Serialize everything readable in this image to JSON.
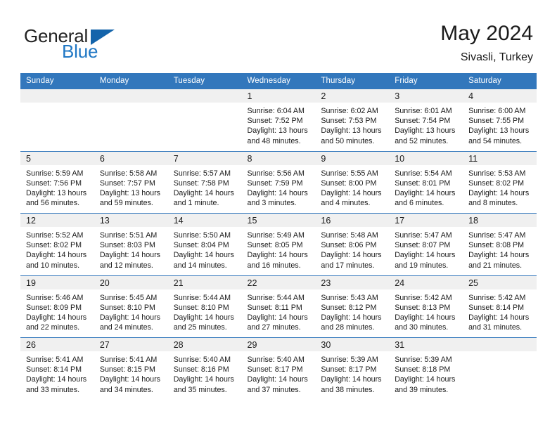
{
  "brand": {
    "name_primary": "General",
    "name_secondary": "Blue",
    "accent_color": "#1f77c4",
    "triangle_color": "#1464ab"
  },
  "header": {
    "month_title": "May 2024",
    "location": "Sivasli, Turkey"
  },
  "calendar": {
    "header_color": "#3277bc",
    "daynum_band_color": "#f0f0f0",
    "weekday_headers": [
      "Sunday",
      "Monday",
      "Tuesday",
      "Wednesday",
      "Thursday",
      "Friday",
      "Saturday"
    ],
    "weeks": [
      [
        {
          "day": "",
          "sunrise": "",
          "sunset": "",
          "daylight_line1": "",
          "daylight_line2": ""
        },
        {
          "day": "",
          "sunrise": "",
          "sunset": "",
          "daylight_line1": "",
          "daylight_line2": ""
        },
        {
          "day": "",
          "sunrise": "",
          "sunset": "",
          "daylight_line1": "",
          "daylight_line2": ""
        },
        {
          "day": "1",
          "sunrise": "Sunrise: 6:04 AM",
          "sunset": "Sunset: 7:52 PM",
          "daylight_line1": "Daylight: 13 hours",
          "daylight_line2": "and 48 minutes."
        },
        {
          "day": "2",
          "sunrise": "Sunrise: 6:02 AM",
          "sunset": "Sunset: 7:53 PM",
          "daylight_line1": "Daylight: 13 hours",
          "daylight_line2": "and 50 minutes."
        },
        {
          "day": "3",
          "sunrise": "Sunrise: 6:01 AM",
          "sunset": "Sunset: 7:54 PM",
          "daylight_line1": "Daylight: 13 hours",
          "daylight_line2": "and 52 minutes."
        },
        {
          "day": "4",
          "sunrise": "Sunrise: 6:00 AM",
          "sunset": "Sunset: 7:55 PM",
          "daylight_line1": "Daylight: 13 hours",
          "daylight_line2": "and 54 minutes."
        }
      ],
      [
        {
          "day": "5",
          "sunrise": "Sunrise: 5:59 AM",
          "sunset": "Sunset: 7:56 PM",
          "daylight_line1": "Daylight: 13 hours",
          "daylight_line2": "and 56 minutes."
        },
        {
          "day": "6",
          "sunrise": "Sunrise: 5:58 AM",
          "sunset": "Sunset: 7:57 PM",
          "daylight_line1": "Daylight: 13 hours",
          "daylight_line2": "and 59 minutes."
        },
        {
          "day": "7",
          "sunrise": "Sunrise: 5:57 AM",
          "sunset": "Sunset: 7:58 PM",
          "daylight_line1": "Daylight: 14 hours",
          "daylight_line2": "and 1 minute."
        },
        {
          "day": "8",
          "sunrise": "Sunrise: 5:56 AM",
          "sunset": "Sunset: 7:59 PM",
          "daylight_line1": "Daylight: 14 hours",
          "daylight_line2": "and 3 minutes."
        },
        {
          "day": "9",
          "sunrise": "Sunrise: 5:55 AM",
          "sunset": "Sunset: 8:00 PM",
          "daylight_line1": "Daylight: 14 hours",
          "daylight_line2": "and 4 minutes."
        },
        {
          "day": "10",
          "sunrise": "Sunrise: 5:54 AM",
          "sunset": "Sunset: 8:01 PM",
          "daylight_line1": "Daylight: 14 hours",
          "daylight_line2": "and 6 minutes."
        },
        {
          "day": "11",
          "sunrise": "Sunrise: 5:53 AM",
          "sunset": "Sunset: 8:02 PM",
          "daylight_line1": "Daylight: 14 hours",
          "daylight_line2": "and 8 minutes."
        }
      ],
      [
        {
          "day": "12",
          "sunrise": "Sunrise: 5:52 AM",
          "sunset": "Sunset: 8:02 PM",
          "daylight_line1": "Daylight: 14 hours",
          "daylight_line2": "and 10 minutes."
        },
        {
          "day": "13",
          "sunrise": "Sunrise: 5:51 AM",
          "sunset": "Sunset: 8:03 PM",
          "daylight_line1": "Daylight: 14 hours",
          "daylight_line2": "and 12 minutes."
        },
        {
          "day": "14",
          "sunrise": "Sunrise: 5:50 AM",
          "sunset": "Sunset: 8:04 PM",
          "daylight_line1": "Daylight: 14 hours",
          "daylight_line2": "and 14 minutes."
        },
        {
          "day": "15",
          "sunrise": "Sunrise: 5:49 AM",
          "sunset": "Sunset: 8:05 PM",
          "daylight_line1": "Daylight: 14 hours",
          "daylight_line2": "and 16 minutes."
        },
        {
          "day": "16",
          "sunrise": "Sunrise: 5:48 AM",
          "sunset": "Sunset: 8:06 PM",
          "daylight_line1": "Daylight: 14 hours",
          "daylight_line2": "and 17 minutes."
        },
        {
          "day": "17",
          "sunrise": "Sunrise: 5:47 AM",
          "sunset": "Sunset: 8:07 PM",
          "daylight_line1": "Daylight: 14 hours",
          "daylight_line2": "and 19 minutes."
        },
        {
          "day": "18",
          "sunrise": "Sunrise: 5:47 AM",
          "sunset": "Sunset: 8:08 PM",
          "daylight_line1": "Daylight: 14 hours",
          "daylight_line2": "and 21 minutes."
        }
      ],
      [
        {
          "day": "19",
          "sunrise": "Sunrise: 5:46 AM",
          "sunset": "Sunset: 8:09 PM",
          "daylight_line1": "Daylight: 14 hours",
          "daylight_line2": "and 22 minutes."
        },
        {
          "day": "20",
          "sunrise": "Sunrise: 5:45 AM",
          "sunset": "Sunset: 8:10 PM",
          "daylight_line1": "Daylight: 14 hours",
          "daylight_line2": "and 24 minutes."
        },
        {
          "day": "21",
          "sunrise": "Sunrise: 5:44 AM",
          "sunset": "Sunset: 8:10 PM",
          "daylight_line1": "Daylight: 14 hours",
          "daylight_line2": "and 25 minutes."
        },
        {
          "day": "22",
          "sunrise": "Sunrise: 5:44 AM",
          "sunset": "Sunset: 8:11 PM",
          "daylight_line1": "Daylight: 14 hours",
          "daylight_line2": "and 27 minutes."
        },
        {
          "day": "23",
          "sunrise": "Sunrise: 5:43 AM",
          "sunset": "Sunset: 8:12 PM",
          "daylight_line1": "Daylight: 14 hours",
          "daylight_line2": "and 28 minutes."
        },
        {
          "day": "24",
          "sunrise": "Sunrise: 5:42 AM",
          "sunset": "Sunset: 8:13 PM",
          "daylight_line1": "Daylight: 14 hours",
          "daylight_line2": "and 30 minutes."
        },
        {
          "day": "25",
          "sunrise": "Sunrise: 5:42 AM",
          "sunset": "Sunset: 8:14 PM",
          "daylight_line1": "Daylight: 14 hours",
          "daylight_line2": "and 31 minutes."
        }
      ],
      [
        {
          "day": "26",
          "sunrise": "Sunrise: 5:41 AM",
          "sunset": "Sunset: 8:14 PM",
          "daylight_line1": "Daylight: 14 hours",
          "daylight_line2": "and 33 minutes."
        },
        {
          "day": "27",
          "sunrise": "Sunrise: 5:41 AM",
          "sunset": "Sunset: 8:15 PM",
          "daylight_line1": "Daylight: 14 hours",
          "daylight_line2": "and 34 minutes."
        },
        {
          "day": "28",
          "sunrise": "Sunrise: 5:40 AM",
          "sunset": "Sunset: 8:16 PM",
          "daylight_line1": "Daylight: 14 hours",
          "daylight_line2": "and 35 minutes."
        },
        {
          "day": "29",
          "sunrise": "Sunrise: 5:40 AM",
          "sunset": "Sunset: 8:17 PM",
          "daylight_line1": "Daylight: 14 hours",
          "daylight_line2": "and 37 minutes."
        },
        {
          "day": "30",
          "sunrise": "Sunrise: 5:39 AM",
          "sunset": "Sunset: 8:17 PM",
          "daylight_line1": "Daylight: 14 hours",
          "daylight_line2": "and 38 minutes."
        },
        {
          "day": "31",
          "sunrise": "Sunrise: 5:39 AM",
          "sunset": "Sunset: 8:18 PM",
          "daylight_line1": "Daylight: 14 hours",
          "daylight_line2": "and 39 minutes."
        },
        {
          "day": "",
          "sunrise": "",
          "sunset": "",
          "daylight_line1": "",
          "daylight_line2": ""
        }
      ]
    ]
  }
}
